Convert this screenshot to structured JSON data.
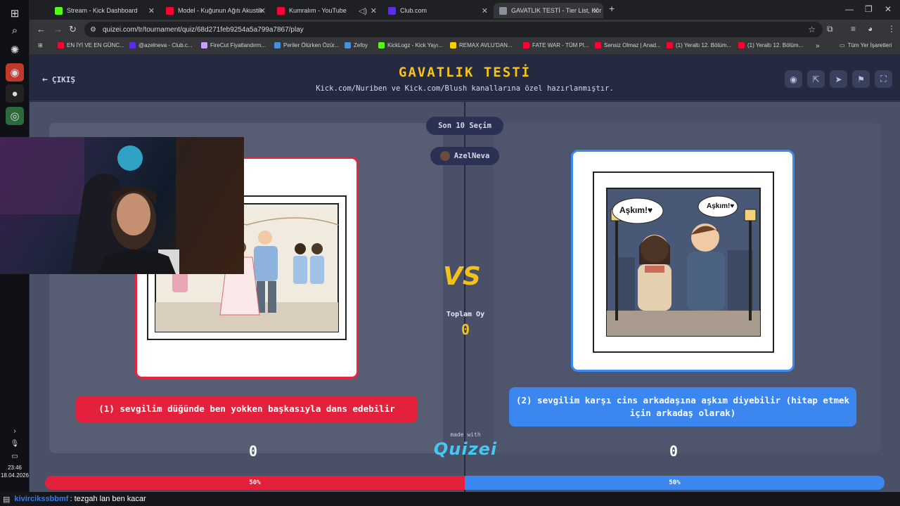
{
  "browser": {
    "tabs": [
      {
        "label": "Stream - Kick Dashboard",
        "color": "#53fc18"
      },
      {
        "label": "Model - Kuğunun Ağıtı Akustik",
        "color": "#ff0033"
      },
      {
        "label": "Kumralım - YouTube",
        "color": "#ff0033"
      },
      {
        "label": "Club.com",
        "color": "#5b2ee6"
      },
      {
        "label": "GAVATLIK TESTİ - Tier List, Kör",
        "color": "#8a8f9b"
      }
    ],
    "url": "quizei.com/tr/tournament/quiz/68d271feb9254a5a799a7867/play",
    "bookmarks": [
      {
        "label": "EN İYİ VE EN GÜNC...",
        "color": "#ff0033"
      },
      {
        "label": "@azelneva - Club.c...",
        "color": "#5b2ee6"
      },
      {
        "label": "FireCut Fiyatlandırm...",
        "color": "#c9a0ff"
      },
      {
        "label": "Periler Ölürken Özür...",
        "color": "#4a90d9"
      },
      {
        "label": "Zefoy",
        "color": "#4a90d9"
      },
      {
        "label": "KickLogz - Kick Yayı...",
        "color": "#53fc18"
      },
      {
        "label": "REMAX AVLU'DAN...",
        "color": "#f5d000"
      },
      {
        "label": "FATE WAR - TÜM Pl...",
        "color": "#ff0033"
      },
      {
        "label": "Sensiz Olmaz | Anad...",
        "color": "#ff0033"
      },
      {
        "label": "(1) Yeraltı 12. Bölüm...",
        "color": "#ff0033"
      },
      {
        "label": "(1) Yeraltı 12. Bölüm...",
        "color": "#ff0033"
      }
    ],
    "all_bookmarks": "Tüm Yer İşaretleri"
  },
  "taskbar": {
    "time": "23:46",
    "date": "18.04.2026"
  },
  "quiz": {
    "exit_label": "ÇIKIŞ",
    "title": "GAVATLIK TESTİ",
    "subtitle": "Kick.com/Nuriben ve Kick.com/Blush kanallarına özel hazırlanmıştır.",
    "last_picks": "Son 10 Seçim",
    "user": "AzelNeva",
    "vs": "VS",
    "total_label": "Toplam Oy",
    "total_value": "0",
    "made_with": "made with",
    "brand": "Quizei",
    "left": {
      "caption": "(1) sevgilim düğünde ben yokken başkasıyla dans edebilir",
      "votes": "0",
      "percent_label": "50%",
      "percent": 0.5,
      "color": "#e3213c"
    },
    "right": {
      "caption": "(2) sevgilim karşı cins arkadaşına aşkım diyebilir (hitap etmek için arkadaş olarak)",
      "votes": "0",
      "percent_label": "50%",
      "percent": 0.5,
      "color": "#3b86ef"
    },
    "speech_her": "Aşkım!♥",
    "speech_him": "Aşkım!♥"
  },
  "chat": {
    "user": "kivircikssbbmf",
    "message": ": tezgah lan ben kacar"
  }
}
